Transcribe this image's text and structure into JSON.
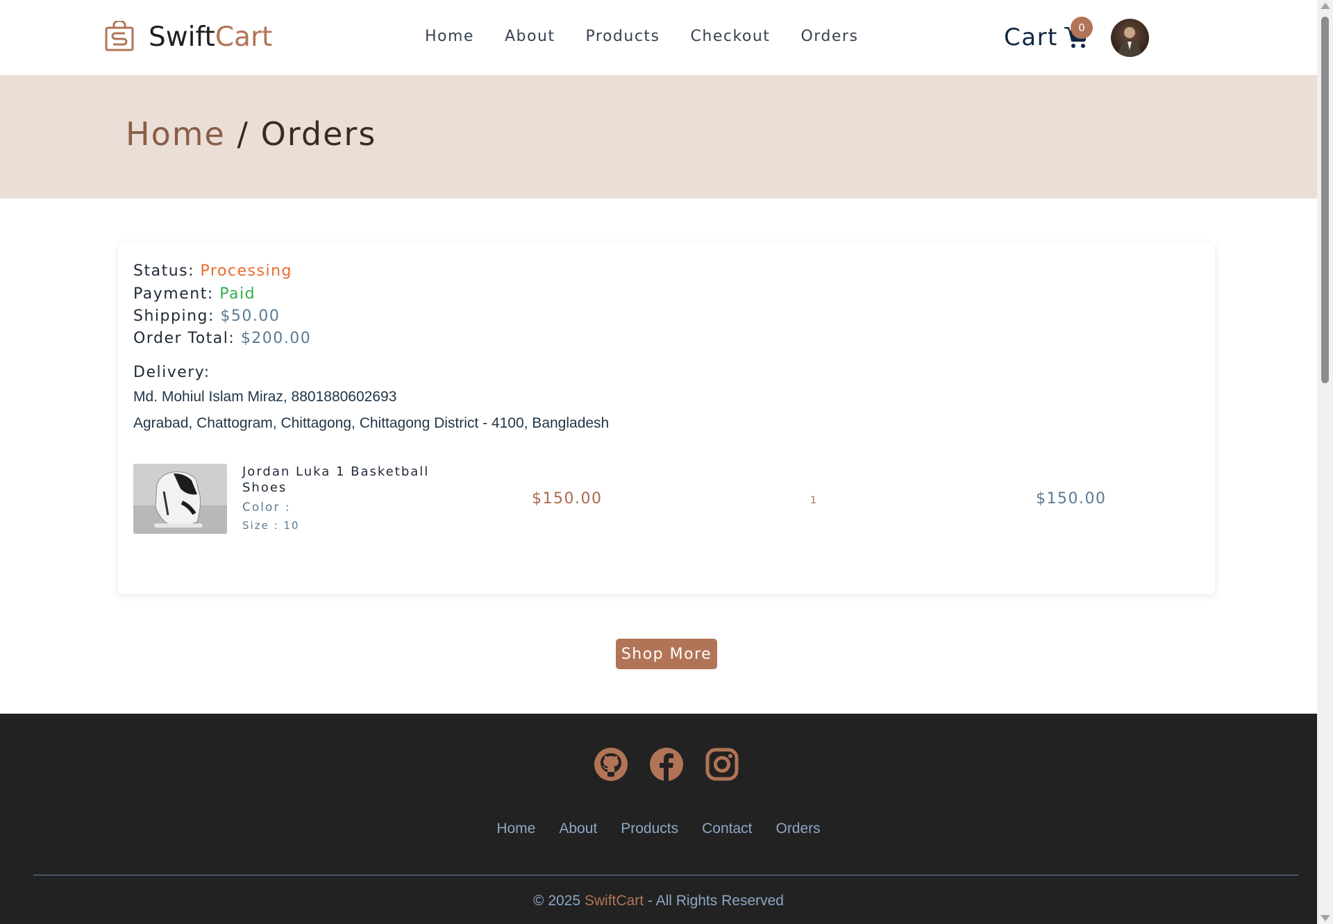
{
  "header": {
    "brand_part1": "Swift",
    "brand_part2": "Cart",
    "nav": [
      "Home",
      "About",
      "Products",
      "Checkout",
      "Orders"
    ],
    "cart_label": "Cart",
    "cart_count": "0"
  },
  "breadcrumb": {
    "home": "Home",
    "separator": " / ",
    "current": "Orders"
  },
  "order": {
    "status_label": "Status:",
    "status_value": "Processing",
    "payment_label": "Payment:",
    "payment_value": "Paid",
    "shipping_label": "Shipping:",
    "shipping_value": "$50.00",
    "total_label": "Order Total:",
    "total_value": "$200.00",
    "delivery_label": "Delivery:",
    "delivery_contact": "Md. Mohiul Islam Miraz, 8801880602693",
    "delivery_address": "Agrabad, Chattogram, Chittagong, Chittagong District - 4100, Bangladesh",
    "items": [
      {
        "name": "Jordan Luka 1 Basketball Shoes",
        "color": "Color :",
        "size": "Size : 10",
        "price": "$150.00",
        "quantity": "1",
        "line_total": "$150.00"
      }
    ]
  },
  "shop_more_label": "Shop More",
  "footer": {
    "socials": [
      "github-icon",
      "facebook-icon",
      "instagram-icon"
    ],
    "nav": [
      "Home",
      "About",
      "Products",
      "Contact",
      "Orders"
    ],
    "copyright_prefix": "© 2025 ",
    "copyright_brand": "SwiftCart",
    "copyright_suffix": " - All Rights Reserved"
  },
  "colors": {
    "accent": "#b17457",
    "banner": "#eaded7",
    "status_processing": "#ea6a2c",
    "payment_paid": "#2fb14a",
    "footer_bg": "#222222"
  }
}
